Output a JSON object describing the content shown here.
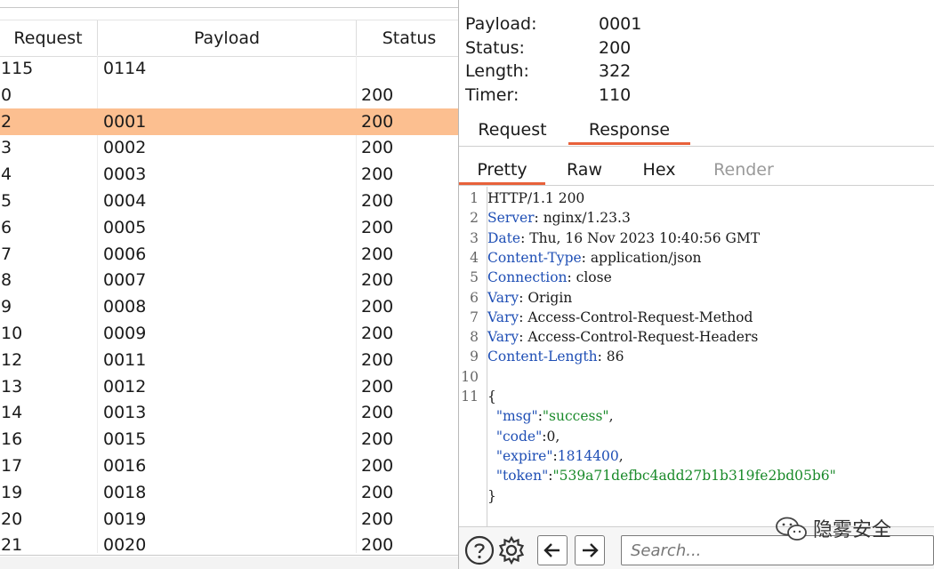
{
  "table": {
    "columns": [
      "Request",
      "Payload",
      "Status"
    ],
    "rows": [
      {
        "request": "115",
        "payload": "0114",
        "status": ""
      },
      {
        "request": "0",
        "payload": "",
        "status": "200"
      },
      {
        "request": "2",
        "payload": "0001",
        "status": "200"
      },
      {
        "request": "3",
        "payload": "0002",
        "status": "200"
      },
      {
        "request": "4",
        "payload": "0003",
        "status": "200"
      },
      {
        "request": "5",
        "payload": "0004",
        "status": "200"
      },
      {
        "request": "6",
        "payload": "0005",
        "status": "200"
      },
      {
        "request": "7",
        "payload": "0006",
        "status": "200"
      },
      {
        "request": "8",
        "payload": "0007",
        "status": "200"
      },
      {
        "request": "9",
        "payload": "0008",
        "status": "200"
      },
      {
        "request": "10",
        "payload": "0009",
        "status": "200"
      },
      {
        "request": "12",
        "payload": "0011",
        "status": "200"
      },
      {
        "request": "13",
        "payload": "0012",
        "status": "200"
      },
      {
        "request": "14",
        "payload": "0013",
        "status": "200"
      },
      {
        "request": "16",
        "payload": "0015",
        "status": "200"
      },
      {
        "request": "17",
        "payload": "0016",
        "status": "200"
      },
      {
        "request": "19",
        "payload": "0018",
        "status": "200"
      },
      {
        "request": "20",
        "payload": "0019",
        "status": "200"
      },
      {
        "request": "21",
        "payload": "0020",
        "status": "200"
      }
    ],
    "selected_request": "2",
    "selected_color": "#fcbf90"
  },
  "details": {
    "payload_label": "Payload:",
    "payload_value": "0001",
    "status_label": "Status:",
    "status_value": "200",
    "length_label": "Length:",
    "length_value": "322",
    "timer_label": "Timer:",
    "timer_value": "110"
  },
  "tabs": {
    "request": "Request",
    "response": "Response",
    "active": "Response"
  },
  "view_tabs": {
    "pretty": "Pretty",
    "raw": "Raw",
    "hex": "Hex",
    "render": "Render",
    "active": "Pretty"
  },
  "accent_color": "#e8613a",
  "response_lines": [
    [
      {
        "t": "HTTP/1.1 200",
        "c": ""
      }
    ],
    [
      {
        "t": "Server",
        "c": "hdr"
      },
      {
        "t": ": nginx/1.23.3",
        "c": ""
      }
    ],
    [
      {
        "t": "Date",
        "c": "hdr"
      },
      {
        "t": ": Thu, 16 Nov 2023 10:40:56 GMT",
        "c": ""
      }
    ],
    [
      {
        "t": "Content-Type",
        "c": "hdr"
      },
      {
        "t": ": application/json",
        "c": ""
      }
    ],
    [
      {
        "t": "Connection",
        "c": "hdr"
      },
      {
        "t": ": close",
        "c": ""
      }
    ],
    [
      {
        "t": "Vary",
        "c": "hdr"
      },
      {
        "t": ": Origin",
        "c": ""
      }
    ],
    [
      {
        "t": "Vary",
        "c": "hdr"
      },
      {
        "t": ": Access-Control-Request-Method",
        "c": ""
      }
    ],
    [
      {
        "t": "Vary",
        "c": "hdr"
      },
      {
        "t": ": Access-Control-Request-Headers",
        "c": ""
      }
    ],
    [
      {
        "t": "Content-Length",
        "c": "hdr"
      },
      {
        "t": ": 86",
        "c": ""
      }
    ],
    [],
    [
      {
        "t": "{",
        "c": ""
      }
    ],
    [
      {
        "t": "  \"msg\"",
        "c": "key"
      },
      {
        "t": ":",
        "c": ""
      },
      {
        "t": "\"success\"",
        "c": "str"
      },
      {
        "t": ",",
        "c": ""
      }
    ],
    [
      {
        "t": "  \"code\"",
        "c": "key"
      },
      {
        "t": ":0,",
        "c": ""
      }
    ],
    [
      {
        "t": "  \"expire\"",
        "c": "key"
      },
      {
        "t": ":",
        "c": ""
      },
      {
        "t": "1814400",
        "c": "num"
      },
      {
        "t": ",",
        "c": ""
      }
    ],
    [
      {
        "t": "  \"token\"",
        "c": "key"
      },
      {
        "t": ":",
        "c": ""
      },
      {
        "t": "\"539a71defbc4add27b1b319fe2bd05b6\"",
        "c": "str"
      }
    ],
    [
      {
        "t": "}",
        "c": ""
      }
    ]
  ],
  "line_numbers": [
    "1",
    "2",
    "3",
    "4",
    "5",
    "6",
    "7",
    "8",
    "9",
    "10",
    "11",
    "",
    "",
    "",
    "",
    ""
  ],
  "bottom_bar": {
    "help_icon": "help-icon",
    "settings_icon": "gear-icon",
    "back_icon": "arrow-left-icon",
    "forward_icon": "arrow-right-icon",
    "search_placeholder": "Search..."
  },
  "watermark": {
    "text": "隐雾安全",
    "icon": "wechat-icon"
  }
}
